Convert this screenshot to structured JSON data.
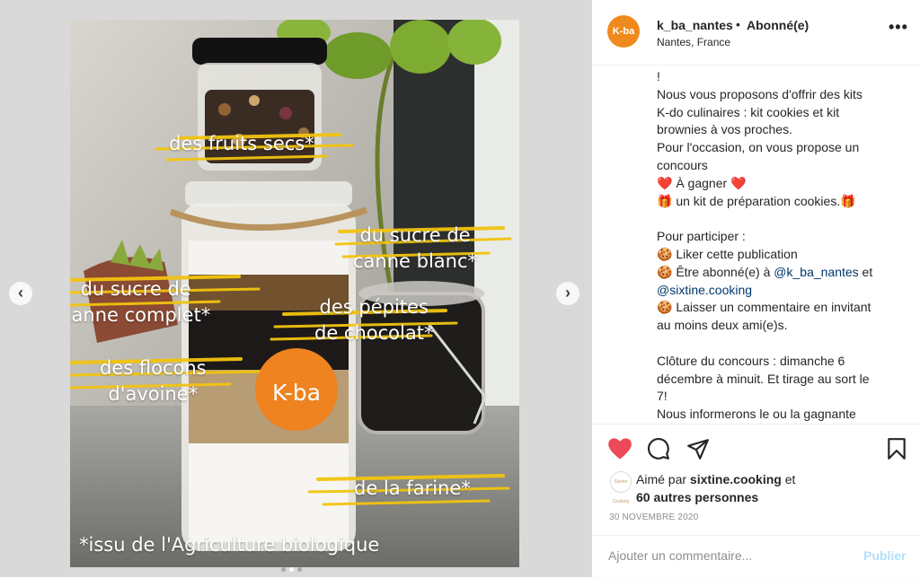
{
  "post": {
    "username": "k_ba_nantes",
    "separator": "•",
    "follow_status": "Abonné(e)",
    "location": "Nantes, France",
    "more_label": "•••",
    "avatar_text": "K-ba",
    "caption_lines": [
      "!",
      "Nous vous proposons d'offrir des kits",
      "K-do culinaires : kit cookies et kit",
      "brownies à vos proches.",
      "Pour l'occasion, on vous propose un",
      "concours",
      "❤️ À gagner ❤️",
      "🎁 un kit de préparation cookies.🎁",
      "",
      "Pour participer :",
      "🍪 Liker cette publication",
      "🍪 Être abonné(e) à ",
      "@sixtine.cooking",
      "🍪 Laisser un commentaire en invitant",
      "au moins deux ami(e)s.",
      "",
      "Clôture du concours : dimanche 6",
      "décembre à minuit. Et tirage au sort le",
      "7!",
      "Nous informerons le ou la gagnante"
    ],
    "mention_1": "@k_ba_nantes",
    "mention_1_suffix": " et",
    "liked_prefix": "Aimé par ",
    "liked_by": "sixtine.cooking",
    "liked_suffix": " et",
    "liked_others": "60 autres personnes",
    "date": "30 NOVEMBRE 2020",
    "comment_placeholder": "Ajouter un commentaire...",
    "publish_label": "Publier",
    "liker_avatar_text": "Sixtine Cooking"
  },
  "photo": {
    "overlays": [
      "des fruits secs*",
      "du sucre de\ncanne blanc*",
      "du sucre de\ncanne complet*",
      "des pépites\nde chocolat*",
      "des flocons\nd'avoine*",
      "de la farine*",
      "*issu de l'Agriculture biologique"
    ],
    "label_text": "K-ba",
    "prev_label": "‹",
    "next_label": "›",
    "carousel": {
      "total": 3,
      "active_index": 1
    }
  },
  "colors": {
    "accent_orange": "#f08a1c",
    "like_red": "#ed4956",
    "highlight_yellow": "#f2c40f",
    "link_blue": "#00376b",
    "publish_disabled": "#b2dffc"
  }
}
